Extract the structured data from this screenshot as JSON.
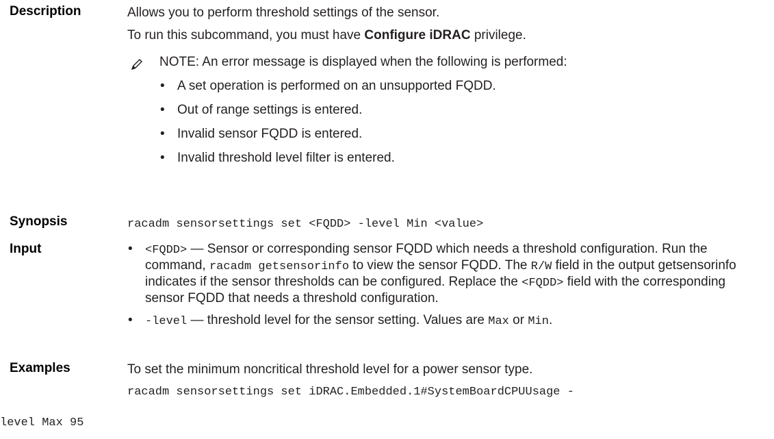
{
  "description": {
    "label": "Description",
    "line1": "Allows you to perform threshold settings of the sensor.",
    "line2_pre": "To run this subcommand, you must have ",
    "line2_bold": "Configure iDRAC",
    "line2_post": " privilege.",
    "note": {
      "icon": "pencil-icon",
      "title": "NOTE:",
      "text": " An error message is displayed when the following is performed:",
      "items": [
        "A set operation is performed on an unsupported FQDD.",
        "Out of range settings is entered.",
        "Invalid sensor FQDD is entered.",
        "Invalid threshold level filter is entered."
      ]
    }
  },
  "synopsis": {
    "label": "Synopsis",
    "code": "racadm sensorsettings set <FQDD> -level Min <value>"
  },
  "input": {
    "label": "Input",
    "item1": {
      "code1": "<FQDD>",
      "t1": " — Sensor or corresponding sensor FQDD which needs a threshold configuration. Run the command, ",
      "code2": "racadm getsensorinfo",
      "t2": " to view the sensor FQDD. The ",
      "code3": "R/W",
      "t3": " field in the output getsensorinfo indicates if the sensor thresholds can be configured. Replace the ",
      "code4": "<FQDD>",
      "t4": " field with the corresponding sensor FQDD that needs a threshold configuration."
    },
    "item2": {
      "code1": "-level",
      "t1": " — threshold level for the sensor setting. Values are ",
      "code2": "Max",
      "t2": " or ",
      "code3": "Min",
      "t3": "."
    }
  },
  "examples": {
    "label": "Examples",
    "text": "To set the minimum noncritical threshold level for a power sensor type.",
    "code_line1": "racadm sensorsettings set iDRAC.Embedded.1#SystemBoardCPUUsage -",
    "code_line2": "level Max 95"
  }
}
